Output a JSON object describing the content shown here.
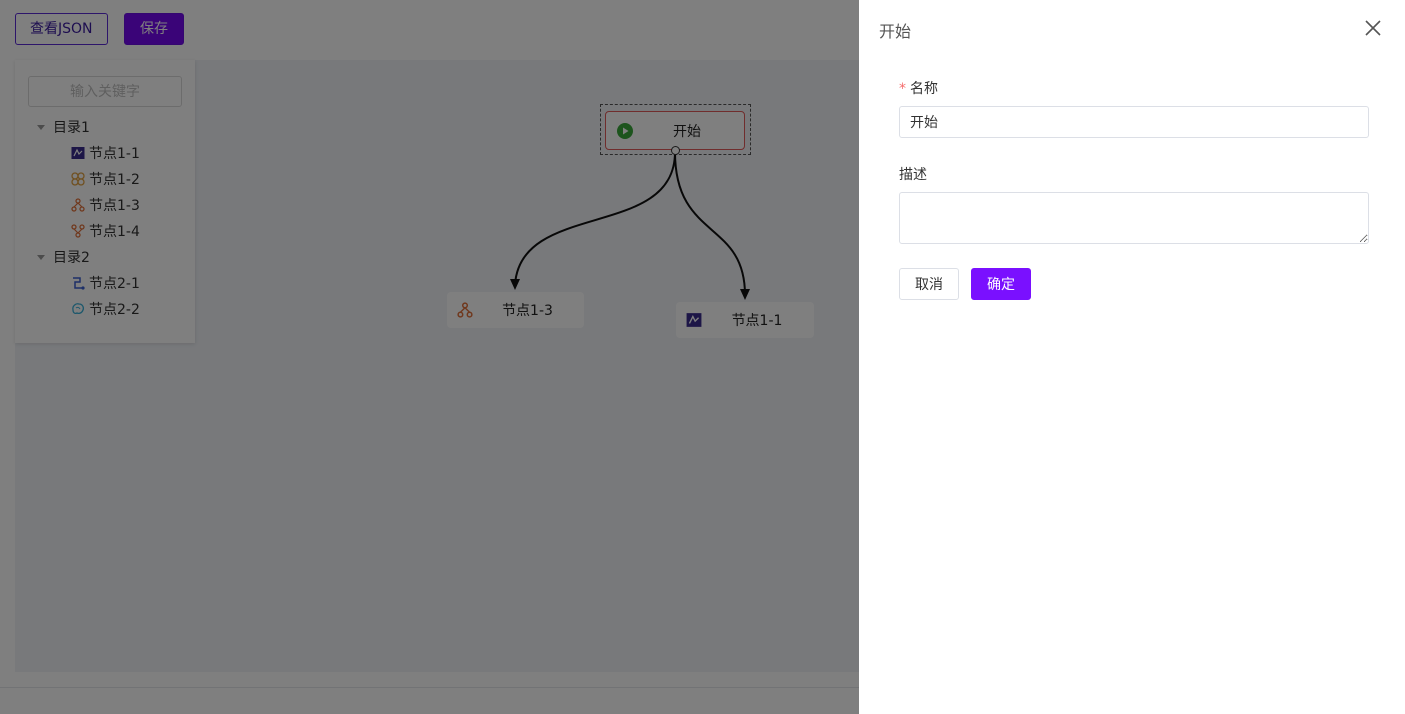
{
  "toolbar": {
    "view_json_label": "查看JSON",
    "save_label": "保存"
  },
  "tree": {
    "search_placeholder": "输入关键字",
    "groups": [
      {
        "label": "目录1",
        "items": [
          {
            "label": "节点1-1",
            "icon": "report-icon"
          },
          {
            "label": "节点1-2",
            "icon": "ring-cluster-icon"
          },
          {
            "label": "节点1-3",
            "icon": "hierarchy-icon"
          },
          {
            "label": "节点1-4",
            "icon": "fork-icon"
          }
        ]
      },
      {
        "label": "目录2",
        "items": [
          {
            "label": "节点2-1",
            "icon": "flow-icon"
          },
          {
            "label": "节点2-2",
            "icon": "brain-icon"
          }
        ]
      }
    ]
  },
  "graph": {
    "start_label": "开始",
    "node_a_label": "节点1-3",
    "node_b_label": "节点1-1"
  },
  "drawer": {
    "title": "开始",
    "name_label": "名称",
    "name_value": "开始",
    "desc_label": "描述",
    "desc_value": "",
    "cancel_label": "取消",
    "ok_label": "确定"
  },
  "colors": {
    "primary": "#7a10ff",
    "required": "#f56c6c"
  }
}
